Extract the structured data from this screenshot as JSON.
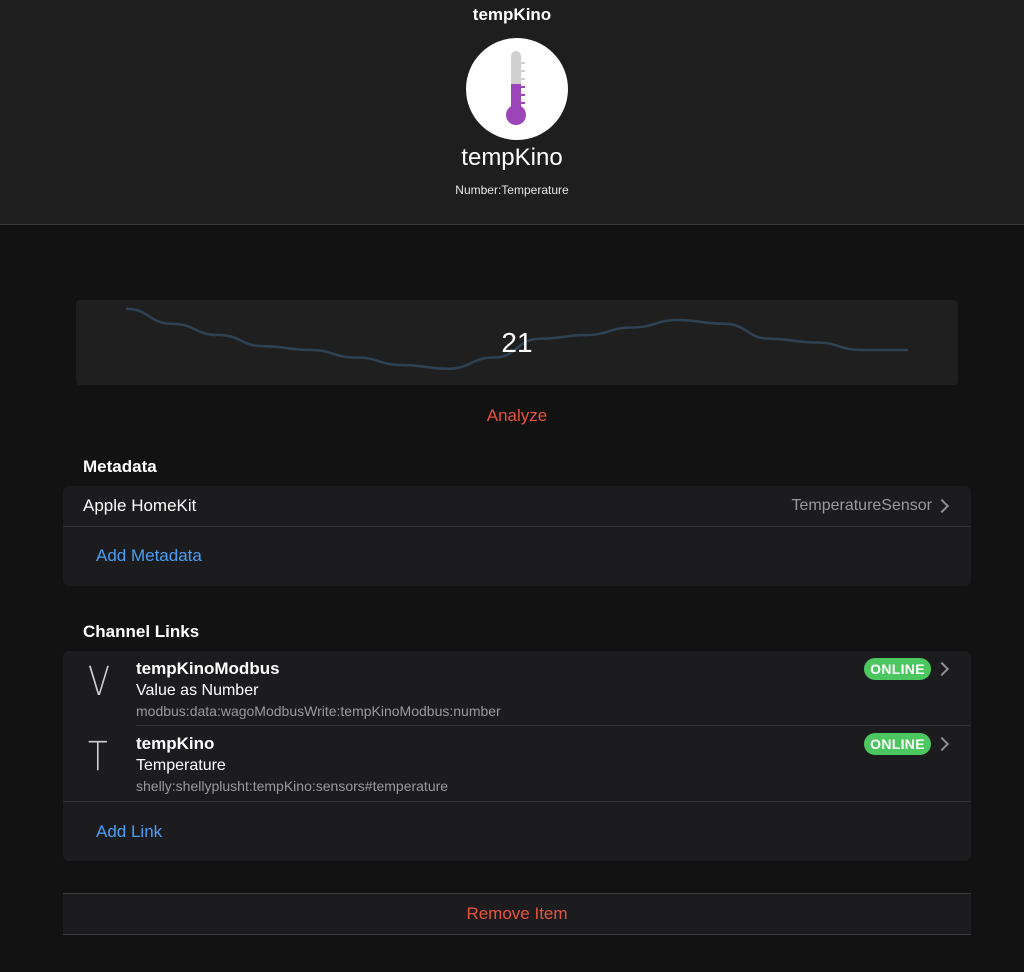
{
  "nav": {
    "title": "tempKino"
  },
  "item": {
    "icon": "thermometer-icon",
    "name": "tempKino",
    "type": "Number:Temperature"
  },
  "chart_data": {
    "type": "line",
    "value_label": "21",
    "values": [
      21.9,
      21.5,
      21.2,
      20.9,
      20.8,
      20.6,
      20.4,
      20.3,
      20.6,
      21.1,
      21.2,
      21.4,
      21.6,
      21.5,
      21.1,
      21.0,
      20.8,
      20.8
    ],
    "ylim": [
      20.0,
      22.0
    ],
    "line_color": "#2f4254",
    "accent": "#e8533e"
  },
  "analyze_label": "Analyze",
  "metadata": {
    "title": "Metadata",
    "items": [
      {
        "label": "Apple HomeKit",
        "value": "TemperatureSensor"
      }
    ],
    "add_label": "Add Metadata"
  },
  "channel_links": {
    "title": "Channel Links",
    "items": [
      {
        "letter": "V",
        "title": "tempKinoModbus",
        "subtitle": "Value as Number",
        "uid": "modbus:data:wagoModbusWrite:tempKinoModbus:number",
        "status": "ONLINE"
      },
      {
        "letter": "T",
        "title": "tempKino",
        "subtitle": "Temperature",
        "uid": "shelly:shellyplusht:tempKino:sensors#temperature",
        "status": "ONLINE"
      }
    ],
    "add_label": "Add Link"
  },
  "remove_label": "Remove Item",
  "colors": {
    "link_blue": "#4a9ef5",
    "danger_red": "#e8533e",
    "online_green": "#4cc760"
  }
}
